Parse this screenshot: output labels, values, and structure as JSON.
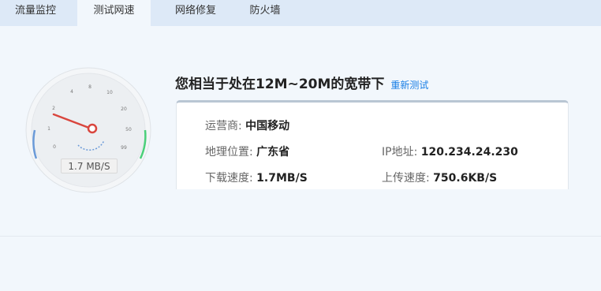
{
  "tabs": [
    {
      "label": "流量监控",
      "active": false
    },
    {
      "label": "测试网速",
      "active": true
    },
    {
      "label": "网络修复",
      "active": false
    },
    {
      "label": "防火墙",
      "active": false
    }
  ],
  "result": {
    "title": "您相当于处在12M~20M的宽带下",
    "retest": "重新测试"
  },
  "info": {
    "isp_label": "运营商:",
    "isp_value": "中国移动",
    "location_label": "地理位置:",
    "location_value": "广东省",
    "ip_label": "IP地址:",
    "ip_value": "120.234.24.230",
    "download_label": "下载速度:",
    "download_value": "1.7MB/S",
    "upload_label": "上传速度:",
    "upload_value": "750.6KB/S"
  },
  "gauge": {
    "ticks": [
      "0",
      "1",
      "2",
      "4",
      "8",
      "10",
      "20",
      "50",
      "99"
    ],
    "reading": "1.7 MB/S",
    "colors": {
      "low": "#6a9ad8",
      "high": "#4bd07a",
      "needle": "#d9463e"
    }
  }
}
